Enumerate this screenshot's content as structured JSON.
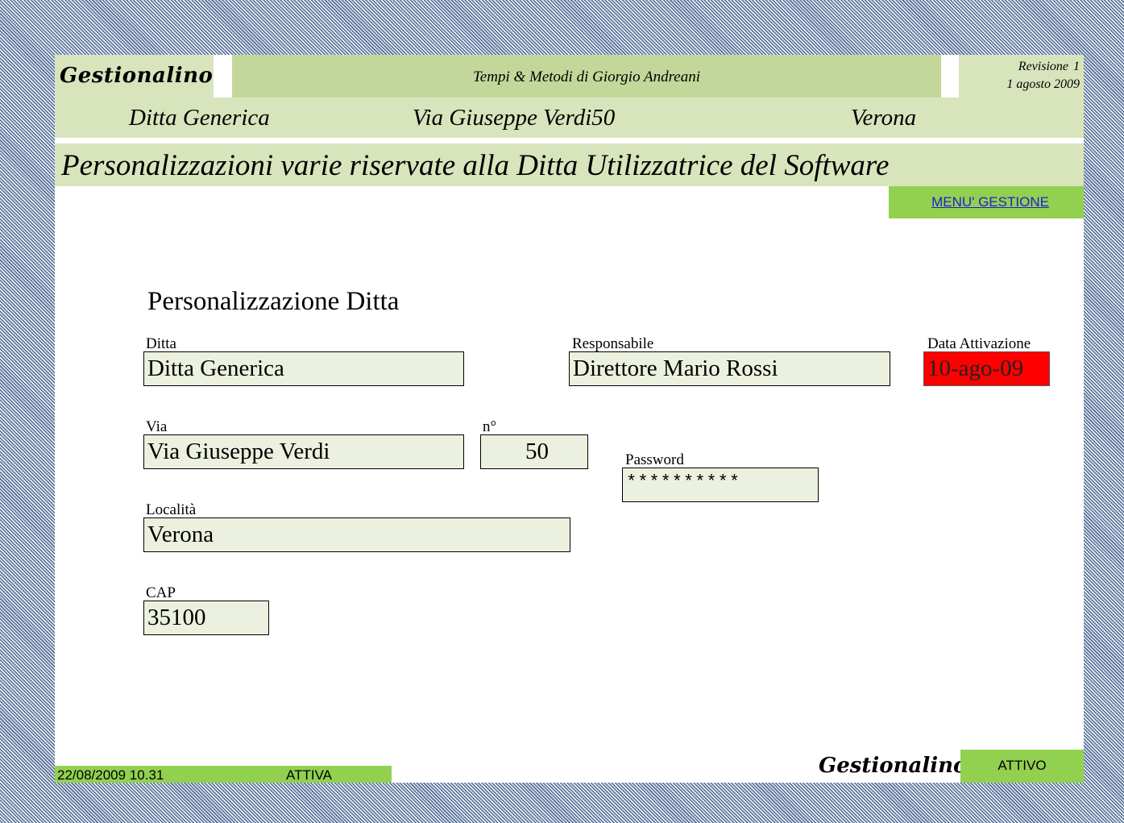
{
  "header": {
    "brand": "Gestionalino",
    "author": "Tempi & Metodi di Giorgio Andreani",
    "revision_label": "Revisione",
    "revision_number": "1",
    "revision_date": "1 agosto 2009"
  },
  "company_bar": {
    "name": "Ditta Generica",
    "address": "Via Giuseppe Verdi50",
    "city": "Verona"
  },
  "page_title": "Personalizzazioni varie riservate alla Ditta Utilizzatrice del Software",
  "menu_link": "MENU' GESTIONE",
  "form": {
    "title": "Personalizzazione Ditta",
    "ditta": {
      "label": "Ditta",
      "value": "Ditta Generica"
    },
    "responsabile": {
      "label": "Responsabile",
      "value": "Direttore Mario Rossi"
    },
    "data_attivazione": {
      "label": "Data Attivazione",
      "value": "10-ago-09"
    },
    "via": {
      "label": "Via",
      "value": "Via Giuseppe Verdi"
    },
    "numero": {
      "label": "n°",
      "value": "50"
    },
    "password": {
      "label": "Password",
      "value": "**********"
    },
    "localita": {
      "label": "Località",
      "value": "Verona"
    },
    "cap": {
      "label": "CAP",
      "value": "35100"
    }
  },
  "footer": {
    "timestamp": "22/08/2009 10.31",
    "status": "ATTIVA",
    "brand": "Gestionalino",
    "button": "ATTIVO"
  },
  "colors": {
    "header_green": "#c4d79b",
    "band_green": "#d8e4bc",
    "button_green": "#92d050",
    "field_bg": "#ebf1de",
    "alert_red": "#ff0000"
  }
}
